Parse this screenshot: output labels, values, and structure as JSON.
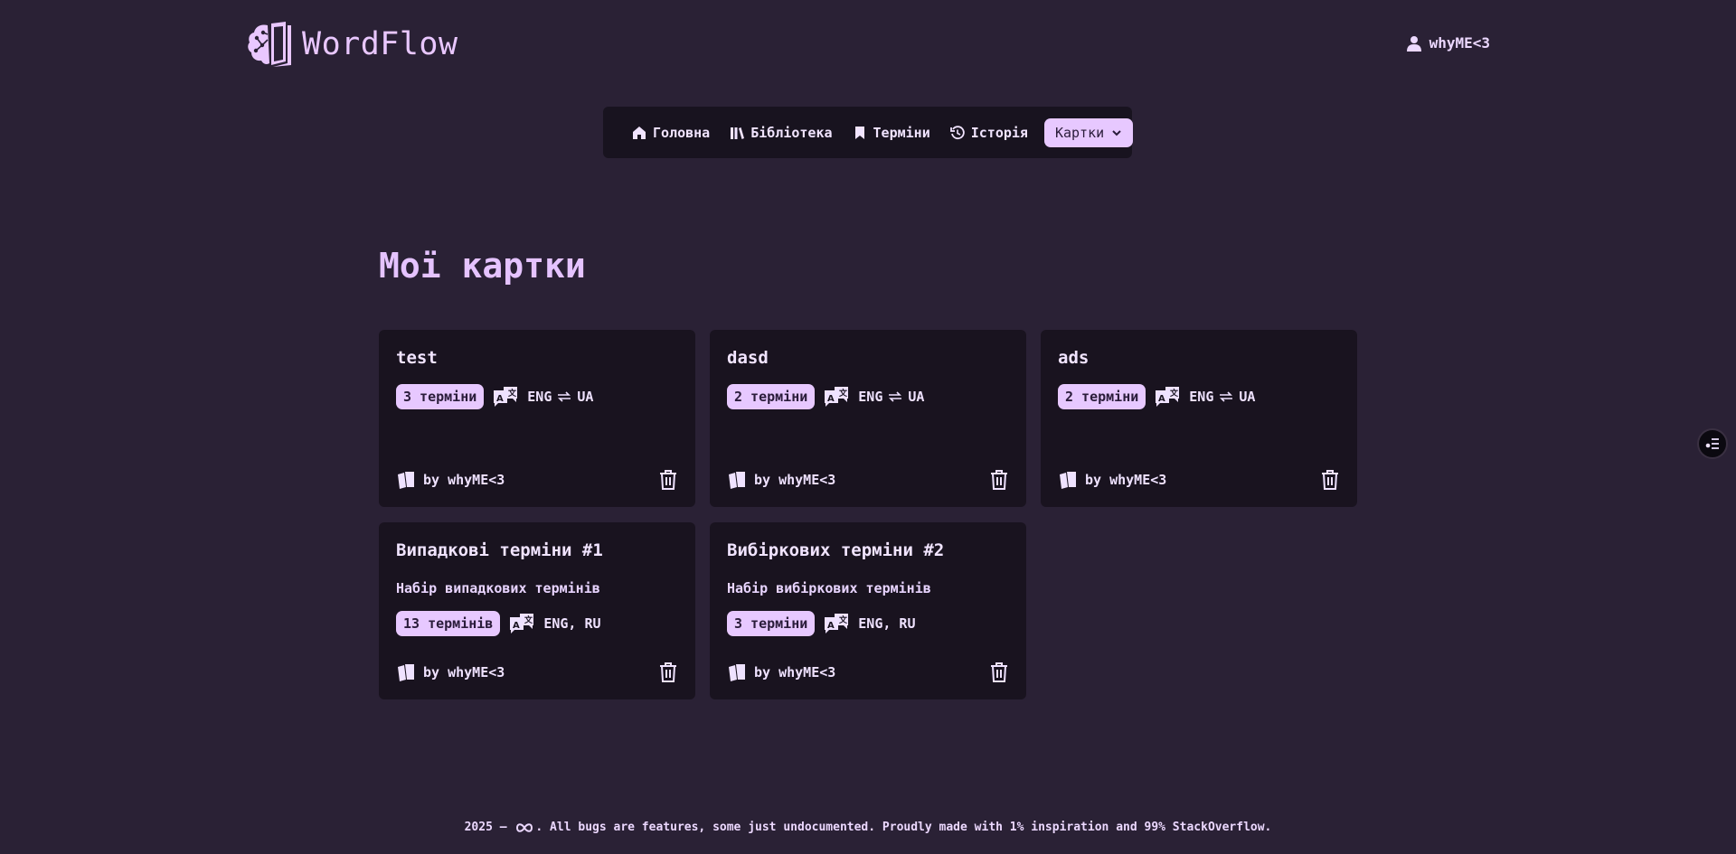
{
  "app": {
    "name": "WordFlow"
  },
  "user": {
    "name": "whyME<3"
  },
  "nav": {
    "items": [
      {
        "label": "Головна",
        "icon": "home-icon"
      },
      {
        "label": "Бібліотека",
        "icon": "library-icon"
      },
      {
        "label": "Терміни",
        "icon": "bookmark-icon"
      },
      {
        "label": "Історія",
        "icon": "history-icon"
      }
    ],
    "cards_label": "Картки"
  },
  "page": {
    "title": "Мої картки"
  },
  "cards": [
    {
      "title": "test",
      "description": "",
      "count": "3 терміни",
      "lang_from": "ENG",
      "lang_to": "UA",
      "author": "by whyME<3"
    },
    {
      "title": "dasd",
      "description": "",
      "count": "2 терміни",
      "lang_from": "ENG",
      "lang_to": "UA",
      "author": "by whyME<3"
    },
    {
      "title": "ads",
      "description": "",
      "count": "2 терміни",
      "lang_from": "ENG",
      "lang_to": "UA",
      "author": "by whyME<3"
    },
    {
      "title": "Випадкові терміни #1",
      "description": "Набір випадкових термінів",
      "count": "13 термінів",
      "langs": "ENG, RU",
      "author": "by whyME<3"
    },
    {
      "title": "Вибіркових терміни #2",
      "description": "Набір вибіркових термінів",
      "count": "3 терміни",
      "langs": "ENG, RU",
      "author": "by whyME<3"
    }
  ],
  "footer": {
    "prefix": "2025 –",
    "text": ". All bugs are features, some just undocumented. Proudly made with 1% inspiration and 99% StackOverflow."
  },
  "colors": {
    "background": "#2a2135",
    "card": "#19131f",
    "accent": "#e7c8ff"
  }
}
